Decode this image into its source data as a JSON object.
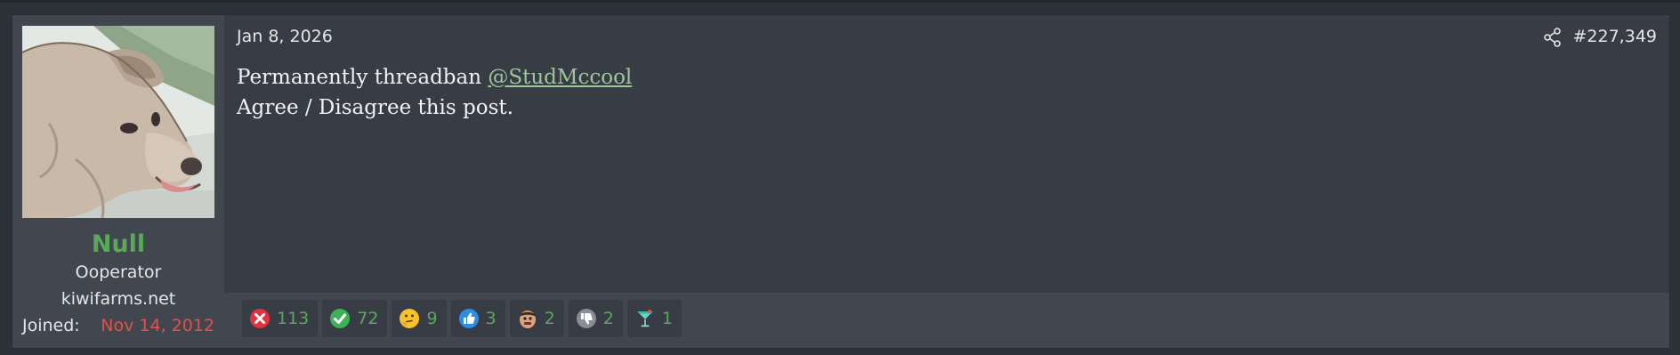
{
  "post": {
    "date": "Jan 8, 2026",
    "number": "#227,349",
    "body_line1_prefix": "Permanently threadban ",
    "mention": "@StudMccool",
    "body_line2": "Agree / Disagree this post."
  },
  "user": {
    "name": "Null",
    "title": "Ooperator",
    "site": "kiwifarms.net",
    "joined_label": "Joined:",
    "joined_date": "Nov 14, 2012"
  },
  "reactions": [
    {
      "icon": "x-mark-icon",
      "count": "113"
    },
    {
      "icon": "check-mark-icon",
      "count": "72"
    },
    {
      "icon": "thinking-face-icon",
      "count": "9"
    },
    {
      "icon": "thumbs-up-icon",
      "count": "3"
    },
    {
      "icon": "face-icon",
      "count": "2"
    },
    {
      "icon": "thumbs-down-icon",
      "count": "2"
    },
    {
      "icon": "cocktail-icon",
      "count": "1"
    }
  ],
  "colors": {
    "username": "#5aa85a",
    "joined_date": "#e2514c",
    "mention": "#9dc69b",
    "reaction_count": "#5aa85a",
    "post_bg": "#383c45",
    "sidebar_bg": "#41464f"
  }
}
